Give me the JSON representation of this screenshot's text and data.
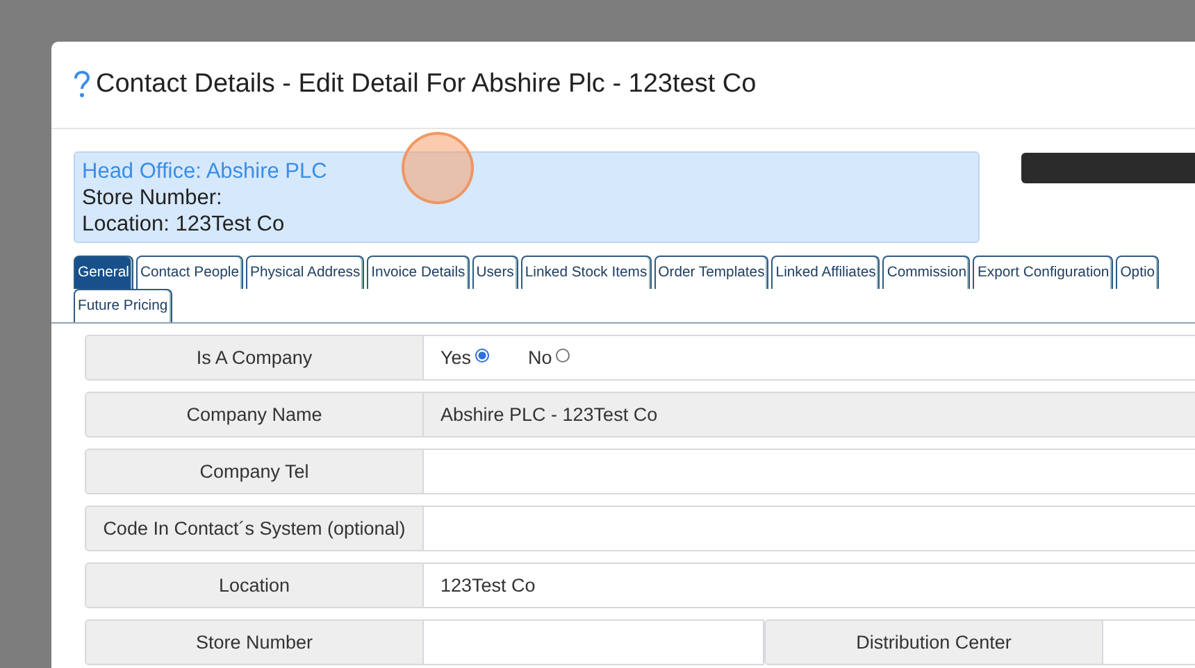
{
  "modal": {
    "title": "Contact Details - Edit Detail For Abshire Plc - 123test Co"
  },
  "summary": [
    {
      "kind": "link",
      "text": "Head Office: Abshire PLC"
    },
    {
      "kind": "text",
      "text": "Store Number:"
    },
    {
      "kind": "text",
      "text": "Location: 123Test Co"
    }
  ],
  "tab_rows": [
    [
      {
        "label": "General",
        "selected": true
      },
      {
        "label": "Contact People",
        "selected": false
      },
      {
        "label": "Physical Address",
        "selected": false
      },
      {
        "label": "Invoice Details",
        "selected": false
      },
      {
        "label": "Users",
        "selected": false
      },
      {
        "label": "Linked Stock Items",
        "selected": false
      },
      {
        "label": "Order Templates",
        "selected": false
      },
      {
        "label": "Linked Affiliates",
        "selected": false
      },
      {
        "label": "Commission",
        "selected": false
      },
      {
        "label": "Export Configuration",
        "selected": false
      },
      {
        "label": "Optio",
        "selected": false
      }
    ],
    [
      {
        "label": "Future Pricing",
        "selected": false
      }
    ]
  ],
  "fields": [
    {
      "kind": "radio",
      "label": "Is A Company",
      "options": [
        {
          "label": "Yes",
          "selected": true
        },
        {
          "label": "No",
          "selected": false
        }
      ]
    },
    {
      "kind": "input",
      "label": "Company Name",
      "value": "Abshire PLC - 123Test Co",
      "disabled": true
    },
    {
      "kind": "input",
      "label": "Company Tel",
      "disabled": false
    },
    {
      "kind": "input",
      "label": "Code In Contact´s System (optional)",
      "disabled": false
    },
    {
      "kind": "input",
      "label": "Location",
      "value": "123Test Co",
      "disabled": false
    },
    {
      "kind": "pair",
      "cells": [
        {
          "label": "Store Number",
          "disabled": false
        },
        {
          "label": "Distribution Center",
          "disabled": false
        }
      ]
    }
  ]
}
